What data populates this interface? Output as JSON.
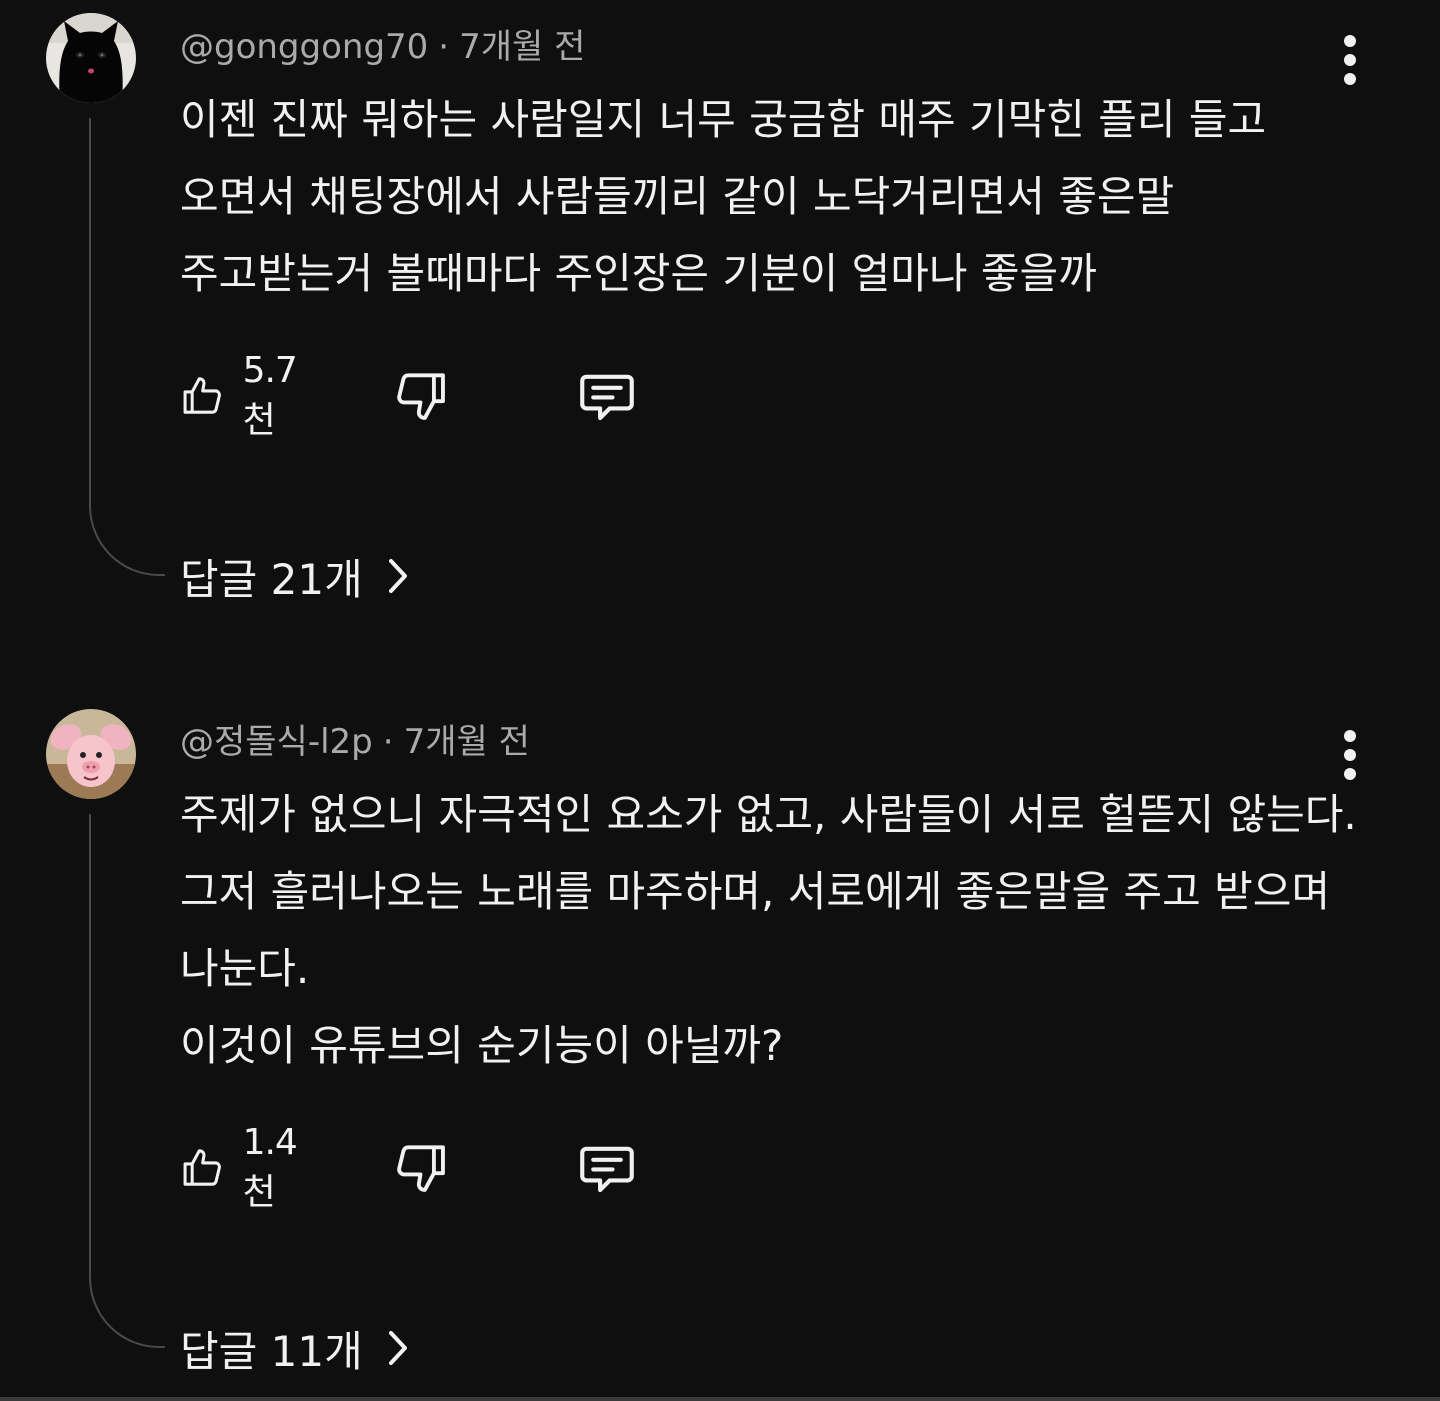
{
  "colors": {
    "background": "#0f0f0f",
    "text_primary": "#f1f1f1",
    "text_secondary": "#aaaaaa",
    "thread_line": "#4a4a4a"
  },
  "comments": [
    {
      "author": "@gonggong70",
      "time": "7개월 전",
      "separator": "·",
      "avatar_icon": "black-cat-avatar",
      "lines": [
        "이젠 진짜 뭐하는 사람일지 너무 궁금함 매주 기막힌 플리 들고",
        "오면서 채팅장에서 사람들끼리 같이 노닥거리면서 좋은말",
        "주고받는거 볼때마다 주인장은 기분이 얼마나 좋을까"
      ],
      "like_count": "5.7천",
      "replies_label": "답글 21개"
    },
    {
      "author": "@정돌식-l2p",
      "time": "7개월 전",
      "separator": "·",
      "avatar_icon": "pink-pig-avatar",
      "lines": [
        "주제가 없으니 자극적인 요소가 없고, 사람들이 서로 헐뜯지 않는다.",
        "그저 흘러나오는 노래를 마주하며, 서로에게 좋은말을 주고 받으며",
        "나눈다.",
        "이것이 유튜브의 순기능이 아닐까?"
      ],
      "like_count": "1.4천",
      "replies_label": "답글 11개"
    }
  ]
}
